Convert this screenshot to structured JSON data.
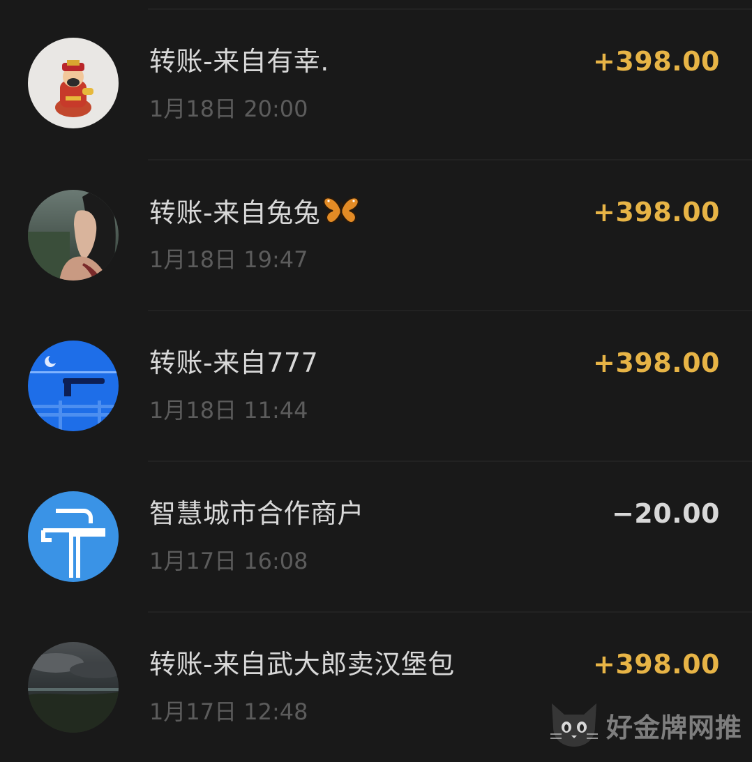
{
  "transactions": [
    {
      "title": "转账-来自有幸.",
      "time": "1月18日 20:00",
      "amount": "+398.00",
      "type": "income",
      "avatar": "fortune-god-avatar"
    },
    {
      "title": "转账-来自兔兔",
      "title_emoji": "butterfly-emoji",
      "time": "1月18日 19:47",
      "amount": "+398.00",
      "type": "income",
      "avatar": "woman-profile-avatar"
    },
    {
      "title": "转账-来自777",
      "time": "1月18日 11:44",
      "amount": "+398.00",
      "type": "income",
      "avatar": "night-illustration-avatar"
    },
    {
      "title": "智慧城市合作商户",
      "time": "1月17日 16:08",
      "amount": "−20.00",
      "type": "expense",
      "avatar": "smart-city-logo-avatar"
    },
    {
      "title": "转账-来自武大郎卖汉堡包",
      "time": "1月17日 12:48",
      "amount": "+398.00",
      "type": "income",
      "avatar": "cloudy-landscape-avatar"
    }
  ],
  "watermark": {
    "text": "好金牌网推",
    "icon": "cat-icon"
  },
  "colors": {
    "background": "#191919",
    "income": "#e7b446",
    "expense": "#d8d8d8",
    "title": "#d8d8d8",
    "time": "#5c5c5c"
  }
}
